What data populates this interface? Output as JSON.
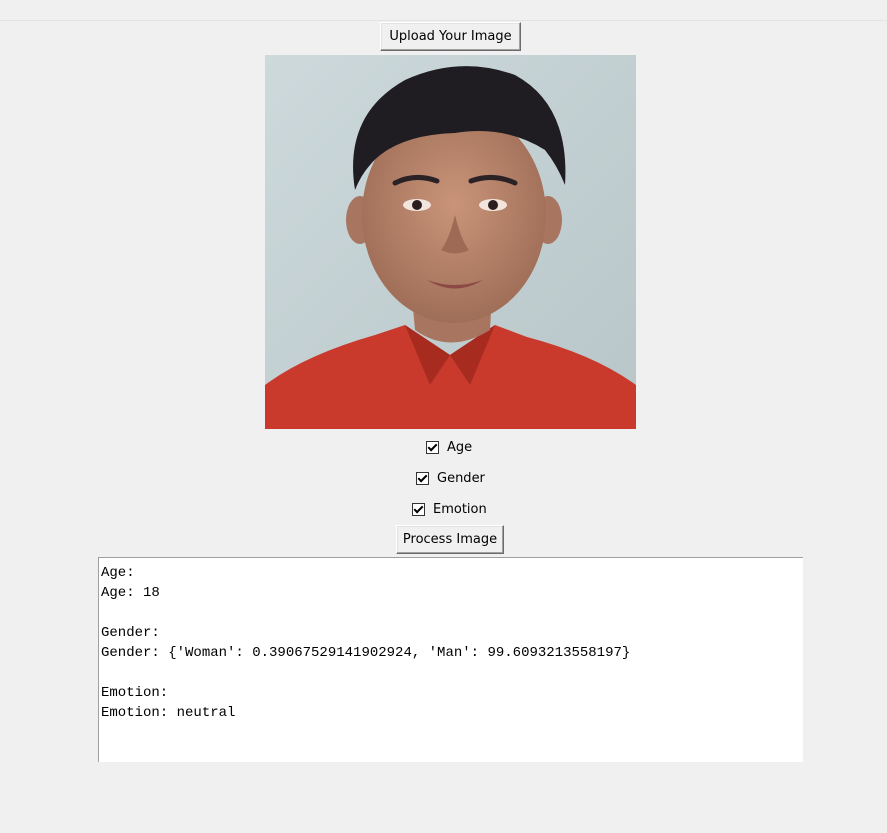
{
  "upload_button": {
    "label": "Upload Your Image"
  },
  "photo": {
    "description_icon": "uploaded-photo"
  },
  "options": [
    {
      "label": "Age",
      "checked": true
    },
    {
      "label": "Gender",
      "checked": true
    },
    {
      "label": "Emotion",
      "checked": true
    }
  ],
  "process_button": {
    "label": "Process Image"
  },
  "output": {
    "lines": [
      "Age:",
      "Age: 18",
      "",
      "Gender:",
      "Gender: {'Woman': 0.39067529141902924, 'Man': 99.6093213558197}",
      "",
      "Emotion:",
      "Emotion: neutral"
    ]
  },
  "colors": {
    "background": "#f0f0f0",
    "shirt": "#c93a2c",
    "hair": "#1f1d22",
    "skin": "#b5836a"
  }
}
